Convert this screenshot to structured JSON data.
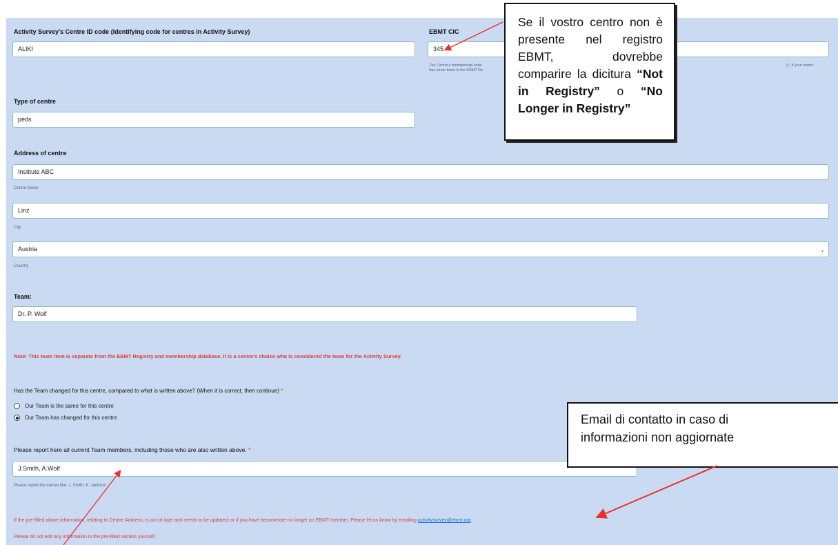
{
  "form": {
    "activity_id": {
      "label": "Activity Survey's Centre ID code (Identifying code for centres in Activity Survey)",
      "value": "ALIKI"
    },
    "ebmt_cic": {
      "label": "EBMT CIC",
      "value": "345",
      "help_line1": "The Centre's membership code",
      "help_line2": "has never been in the EBMT Re",
      "help_right": "y\"; if your centre"
    },
    "type_of_centre": {
      "label": "Type of centre",
      "value": "peds"
    },
    "address": {
      "label": "Address of centre",
      "centre_name": {
        "value": "Institute ABC",
        "sublabel": "Centre Name"
      },
      "city": {
        "value": "Linz",
        "sublabel": "City"
      },
      "country": {
        "value": "Austria",
        "sublabel": "Country"
      }
    },
    "team": {
      "label": "Team:",
      "value": "Dr. P. Wolf"
    },
    "note": "Note: This team item is separate from the EBMT Registry and membership database. It is a centre's choice who is considered the team for the Activity Survey.",
    "team_changed": {
      "question": "Has the Team changed for this centre, compared to what is written above? (When it is correct, then continue)",
      "required_mark": "*",
      "options": [
        {
          "label": "Our Team is the same for this centre",
          "checked": false
        },
        {
          "label": "Our Team has changed for this centre",
          "checked": true
        }
      ]
    },
    "team_members": {
      "label": "Please report here all current Team members, including those who are also written above.",
      "required_mark": "*",
      "value": "J.Smith, A.Wolf",
      "help": "Please report the names like: J. Smith, K. Jackson"
    },
    "footer": {
      "update_text": "If the pre-filled above information, relating to Centre Address, is out of date and needs to be updated; or if you have become/are no longer an EBMT member. Please let us know by emailing",
      "email": "activitysurvey@ebmt.org",
      "edit_warning": "Please do not edit any information in the pre-filled section yourself."
    }
  },
  "callouts": {
    "registry": {
      "line1": "Se il vostro centro non è presente nel registro EBMT, dovrebbe comparire la dicitura",
      "bold1": "“Not in Registry”",
      "middle": "o",
      "bold2": "“No Longer in Registry”"
    },
    "email": {
      "line1": "Email di contatto in caso di",
      "line2": "informazioni non aggiornate"
    }
  },
  "colors": {
    "panel": "#c9daf2",
    "accent_red": "#e03a3a",
    "link": "#1a6fd8",
    "arrow": "#e8302f"
  }
}
